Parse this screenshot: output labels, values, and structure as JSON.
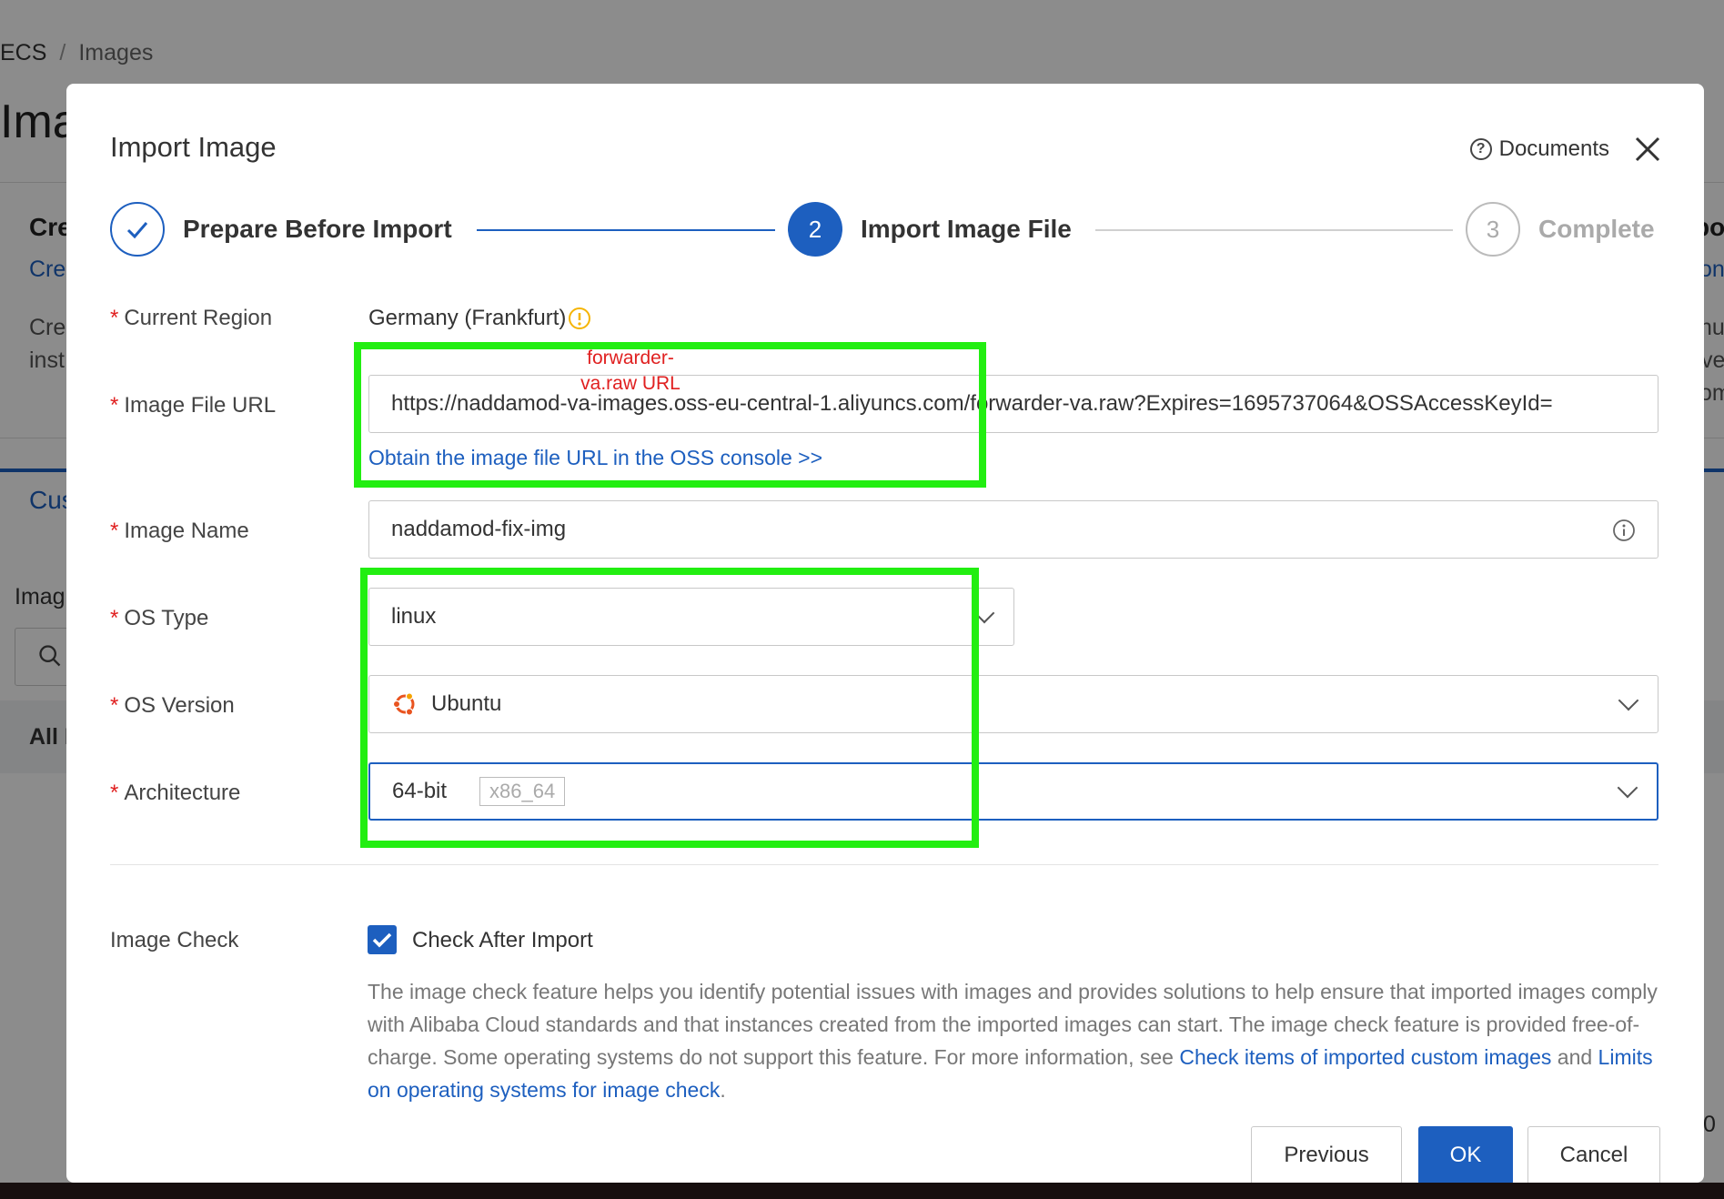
{
  "background": {
    "breadcrumb": [
      "ECS",
      "Images"
    ],
    "page_title": "Ima",
    "card_title": "Cre",
    "card_link": "Cre",
    "card_text_1": "Cre",
    "card_text_2": "inst",
    "right_title": "po",
    "right_link": "on",
    "right_text_1": "nua",
    "right_text_2": "ve",
    "right_text_3": "om",
    "tab_label": "Cus",
    "filter_label": "Imag",
    "row_label": "All I",
    "right_edge_number": "0"
  },
  "modal": {
    "title": "Import Image",
    "documents_label": "Documents",
    "steps": [
      {
        "number": "1",
        "label": "Prepare Before Import",
        "status": "done"
      },
      {
        "number": "2",
        "label": "Import Image File",
        "status": "active"
      },
      {
        "number": "3",
        "label": "Complete",
        "status": "pending"
      }
    ],
    "form": {
      "region": {
        "label": "Current Region",
        "value": "Germany (Frankfurt)"
      },
      "image_url": {
        "label": "Image File URL",
        "value": "https://naddamod-va-images.oss-eu-central-1.aliyuncs.com/forwarder-va.raw?Expires=1695737064&OSSAccessKeyId=",
        "link": "Obtain the image file URL in the OSS console >>"
      },
      "image_name": {
        "label": "Image Name",
        "value": "naddamod-fix-img"
      },
      "os_type": {
        "label": "OS Type",
        "value": "linux"
      },
      "os_version": {
        "label": "OS Version",
        "value": "Ubuntu"
      },
      "architecture": {
        "label": "Architecture",
        "value": "64-bit",
        "tag": "x86_64"
      }
    },
    "annotation": {
      "line1": "forwarder-",
      "line2": "va.raw URL"
    },
    "image_check": {
      "label": "Image Check",
      "checkbox_label": "Check After Import",
      "checked": true,
      "description": "The image check feature helps you identify potential issues with images and provides solutions to help ensure that imported images comply with Alibaba Cloud standards and that instances created from the imported images can start. The image check feature is provided free-of-charge. Some operating systems do not support this feature. For more information, see",
      "link1": "Check items of imported custom images",
      "and_text": "and",
      "link2": "Limits on operating systems for image check",
      "period": "."
    },
    "buttons": {
      "previous": "Previous",
      "ok": "OK",
      "cancel": "Cancel"
    }
  },
  "colors": {
    "primary": "#1d5fbf",
    "required": "#e02020",
    "annotation_box": "#22ee11",
    "warning": "#f5b400"
  }
}
